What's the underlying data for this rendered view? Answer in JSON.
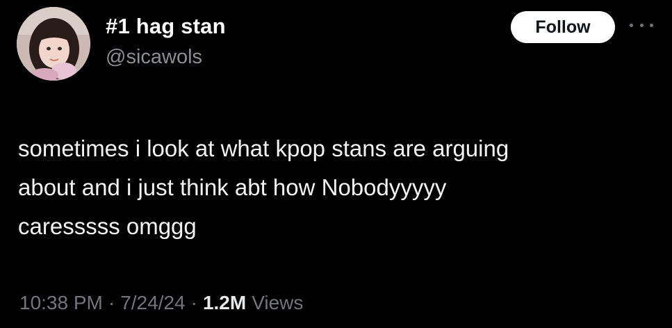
{
  "author": {
    "display_name": "#1 hag stan",
    "handle": "@sicawols"
  },
  "actions": {
    "follow_label": "Follow",
    "more_icon": "more-horizontal-icon"
  },
  "tweet": {
    "lines": [
      "sometimes i look at what kpop stans are arguing",
      "about and i just think abt how Nobodyyyyy",
      "caresssss omggg"
    ]
  },
  "meta": {
    "time": "10:38 PM",
    "separator": "·",
    "date": "7/24/24",
    "views_count": "1.2M",
    "views_label": "Views"
  },
  "colors": {
    "background": "#000000",
    "text_primary": "#e7e9ea",
    "text_secondary": "#71767b",
    "follow_button_bg": "#ffffff",
    "follow_button_text": "#0f1419"
  }
}
